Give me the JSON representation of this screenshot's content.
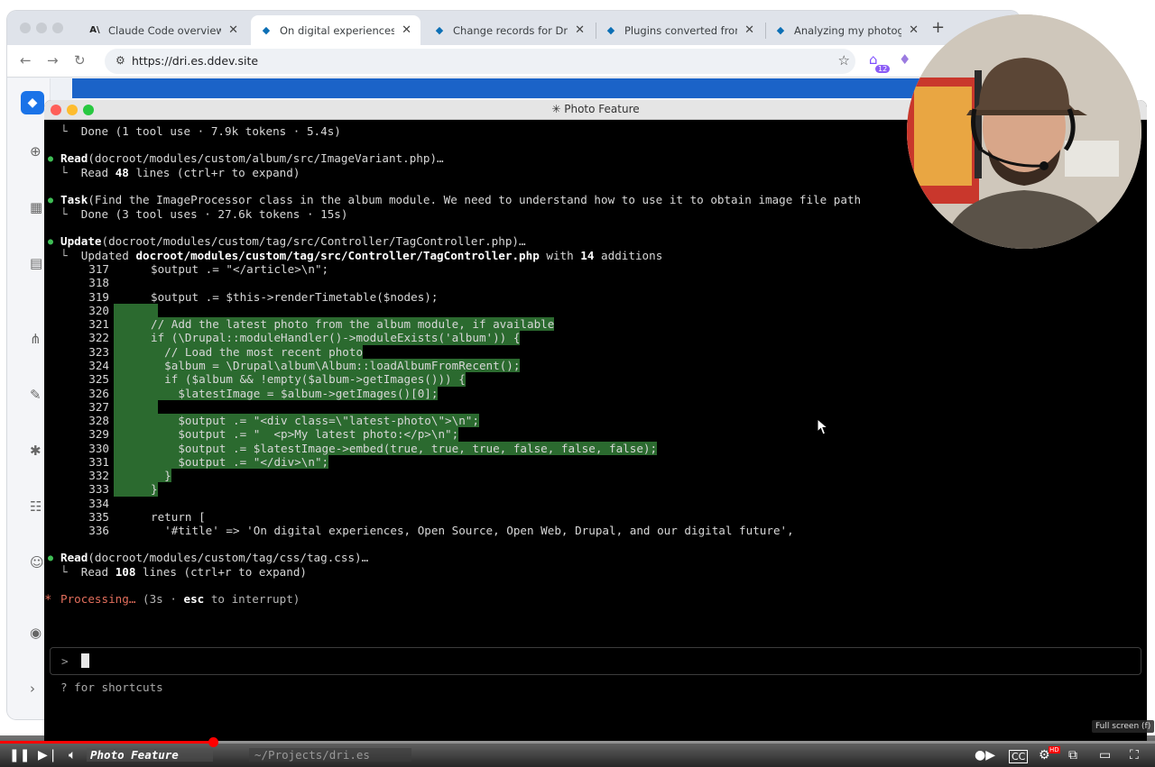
{
  "browser": {
    "tabs": [
      {
        "title": "Claude Code overview - A",
        "icon": "anthropic-icon"
      },
      {
        "title": "On digital experiences, O",
        "icon": "drupal-icon"
      },
      {
        "title": "Change records for Drupa",
        "icon": "drupal-icon"
      },
      {
        "title": "Plugins converted from A",
        "icon": "drupal-icon"
      },
      {
        "title": "Analyzing my photograph",
        "icon": "drupal-icon"
      }
    ],
    "url": "https://dri.es.ddev.site",
    "extension_badge": "12"
  },
  "terminal": {
    "title": "✳ Photo Feature",
    "lines": {
      "l0": "Done (1 tool use · 7.9k tokens · 5.4s)",
      "read1_tool": "Read",
      "read1_arg": "(docroot/modules/custom/album/src/ImageVariant.php)…",
      "read1_res_pre": "Read ",
      "read1_res_num": "48",
      "read1_res_post": " lines (ctrl+r to expand)",
      "task_tool": "Task",
      "task_arg": "(Find the ImageProcessor class in the album module. We need to understand how to use it to obtain image file path",
      "task_res": "Done (3 tool uses · 27.6k tokens · 15s)",
      "update_tool": "Update",
      "update_arg": "(docroot/modules/custom/tag/src/Controller/TagController.php)…",
      "updated_pre": "Updated ",
      "updated_file": "docroot/modules/custom/tag/src/Controller/TagController.php",
      "updated_mid": " with ",
      "updated_num": "14",
      "updated_post": " additions",
      "read2_tool": "Read",
      "read2_arg": "(docroot/modules/custom/tag/css/tag.css)…",
      "read2_res_pre": "Read ",
      "read2_res_num": "108",
      "read2_res_post": " lines (ctrl+r to expand)",
      "processing_word": "Processing…",
      "processing_pre": " (3s · ",
      "processing_key": "esc",
      "processing_post": " to interrupt)",
      "prompt": ">",
      "shortcuts": "? for shortcuts",
      "branch_sep": "└"
    },
    "code": [
      {
        "n": "317",
        "t": "$output .= \"</article>\\n\";",
        "added": false
      },
      {
        "n": "318",
        "t": "",
        "added": false
      },
      {
        "n": "319",
        "t": "$output .= $this->renderTimetable($nodes);",
        "added": false
      },
      {
        "n": "320",
        "t": "",
        "added": true
      },
      {
        "n": "321",
        "t": "// Add the latest photo from the album module, if available",
        "added": true
      },
      {
        "n": "322",
        "t": "if (\\Drupal::moduleHandler()->moduleExists('album')) {",
        "added": true
      },
      {
        "n": "323",
        "t": "  // Load the most recent photo",
        "added": true
      },
      {
        "n": "324",
        "t": "  $album = \\Drupal\\album\\Album::loadAlbumFromRecent();",
        "added": true
      },
      {
        "n": "325",
        "t": "  if ($album && !empty($album->getImages())) {",
        "added": true
      },
      {
        "n": "326",
        "t": "    $latestImage = $album->getImages()[0];",
        "added": true
      },
      {
        "n": "327",
        "t": "",
        "added": true
      },
      {
        "n": "328",
        "t": "    $output .= \"<div class=\\\"latest-photo\\\">\\n\";",
        "added": true
      },
      {
        "n": "329",
        "t": "    $output .= \"  <p>My latest photo:</p>\\n\";",
        "added": true
      },
      {
        "n": "330",
        "t": "    $output .= $latestImage->embed(true, true, true, false, false, false);",
        "added": true
      },
      {
        "n": "331",
        "t": "    $output .= \"</div>\\n\";",
        "added": true
      },
      {
        "n": "332",
        "t": "  }",
        "added": true
      },
      {
        "n": "333",
        "t": "}",
        "added": true
      },
      {
        "n": "334",
        "t": "",
        "added": false
      },
      {
        "n": "335",
        "t": "return [",
        "added": false
      },
      {
        "n": "336",
        "t": "  '#title' => 'On digital experiences, Open Source, Open Web, Drupal, and our digital future',",
        "added": false
      }
    ]
  },
  "video_player": {
    "progress": 0.184,
    "tab1": "Photo Feature",
    "tab2": "~/Projects/dri.es",
    "fullscreen_tooltip": "Full screen (f)",
    "hd_badge": "HD"
  },
  "colors": {
    "added_bg": "#2b6a2f",
    "bullet": "#3fbe55",
    "processing": "#e26e5c",
    "progress": "#ff0000"
  }
}
